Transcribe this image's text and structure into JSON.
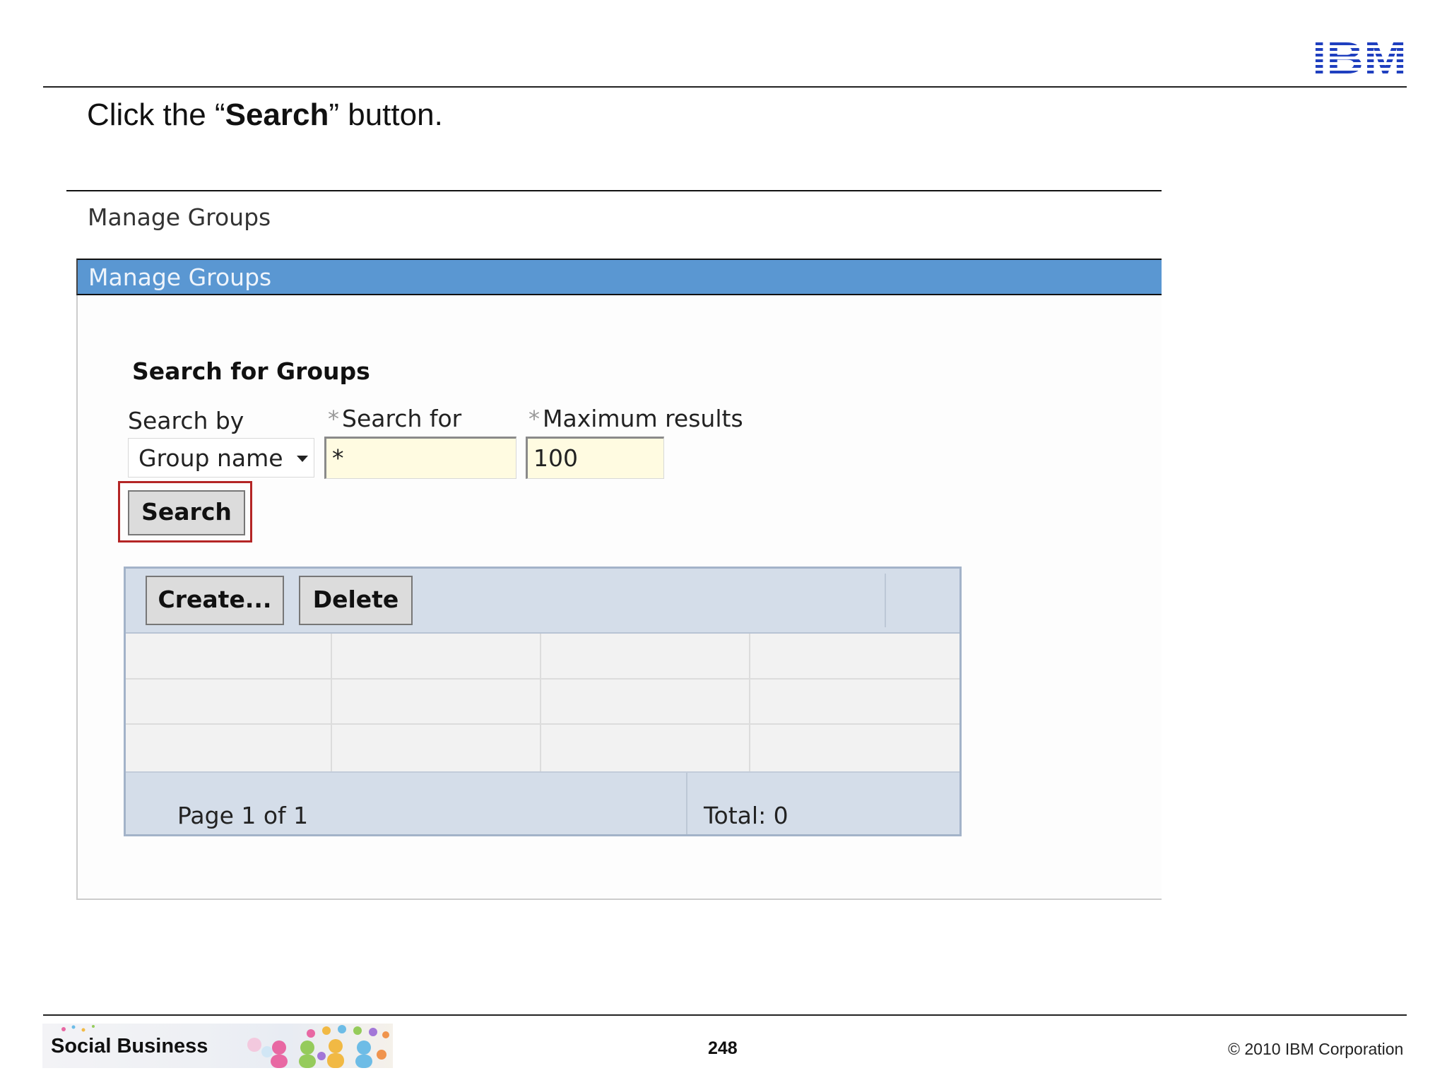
{
  "slide": {
    "instruction_prefix": "Click the “",
    "instruction_bold": "Search",
    "instruction_suffix": "” button.",
    "page_number": "248",
    "copyright": "© 2010 IBM Corporation",
    "footer_banner_text": "Social Business",
    "brand_logo_text": "IBM"
  },
  "app": {
    "breadcrumb": "Manage Groups",
    "panel_title": "Manage Groups",
    "section_title": "Search for Groups",
    "search_by": {
      "label": "Search by",
      "value": "Group name",
      "icon": "chevron-down-icon"
    },
    "search_for": {
      "label": "Search for",
      "value": "*",
      "required_marker": "*"
    },
    "max_results": {
      "label": "Maximum results",
      "value": "100",
      "required_marker": "*"
    },
    "search_button": "Search",
    "table": {
      "buttons": [
        "Create...",
        "Delete"
      ],
      "rows": [
        [
          "",
          "",
          "",
          ""
        ],
        [
          "",
          "",
          "",
          ""
        ],
        [
          "",
          "",
          "",
          ""
        ]
      ],
      "page_info": "Page 1 of 1",
      "total": "Total: 0"
    }
  },
  "colors": {
    "header_blue": "#5a97d2",
    "input_yellow": "#fffbe1",
    "table_bar": "#d4dde9",
    "highlight_red": "#b42525",
    "ibm_blue": "#1f3fbf"
  }
}
